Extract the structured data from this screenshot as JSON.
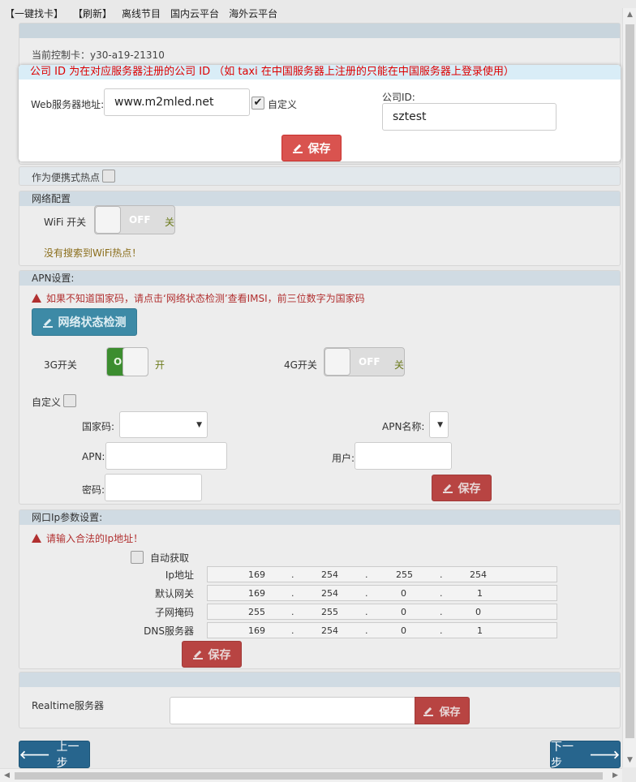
{
  "topnav": [
    "【一键找卡】",
    "【刷新】",
    "离线节目",
    "国内云平台",
    "海外云平台"
  ],
  "current_card": "当前控制卡：y30-a19-21310",
  "modal": {
    "note": "公司 ID 为在对应服务器注册的公司 ID （如 taxi 在中国服务器上注册的只能在中国服务器上登录使用）",
    "web_label": "Web服务器地址:",
    "web_value": "www.m2mled.net",
    "custom_label": "自定义",
    "custom_checked": "✔",
    "company_label": "公司ID:",
    "company_value": "sztest",
    "save": "保存"
  },
  "hotspot_label": "作为便携式热点",
  "network": {
    "head": "网络配置",
    "wifi_label": "WiFi 开关",
    "wifi_toggle": "OFF",
    "wifi_state": "关",
    "no_hotspot": "没有搜索到WiFi热点！"
  },
  "apn": {
    "head": "APN设置:",
    "warning": "如果不知道国家码，请点击‘网络状态检测’查看IMSI，前三位数字为国家码",
    "detect_button": "网络状态检测",
    "g3_label": "3G开关",
    "g3_toggle": "ON",
    "g3_state": "开",
    "g4_label": "4G开关",
    "g4_toggle": "OFF",
    "g4_state": "关",
    "custom_label": "自定义",
    "country_label": "国家码:",
    "apn_name_label": "APN名称:",
    "apn_label": "APN:",
    "user_label": "用户:",
    "password_label": "密码:",
    "save": "保存"
  },
  "ipcfg": {
    "head": "网口Ip参数设置:",
    "warning": "请输入合法的Ip地址！",
    "auto_label": "自动获取",
    "rows": [
      {
        "label": "Ip地址",
        "values": [
          "169",
          "254",
          "255",
          "254"
        ]
      },
      {
        "label": "默认网关",
        "values": [
          "169",
          "254",
          "0",
          "1"
        ]
      },
      {
        "label": "子网掩码",
        "values": [
          "255",
          "255",
          "0",
          "0"
        ]
      },
      {
        "label": "DNS服务器",
        "values": [
          "169",
          "254",
          "0",
          "1"
        ]
      }
    ],
    "save": "保存"
  },
  "realtime": {
    "label": "Realtime服务器",
    "save": "保存"
  },
  "nav": {
    "prev": "上一步",
    "next": "下一步"
  }
}
